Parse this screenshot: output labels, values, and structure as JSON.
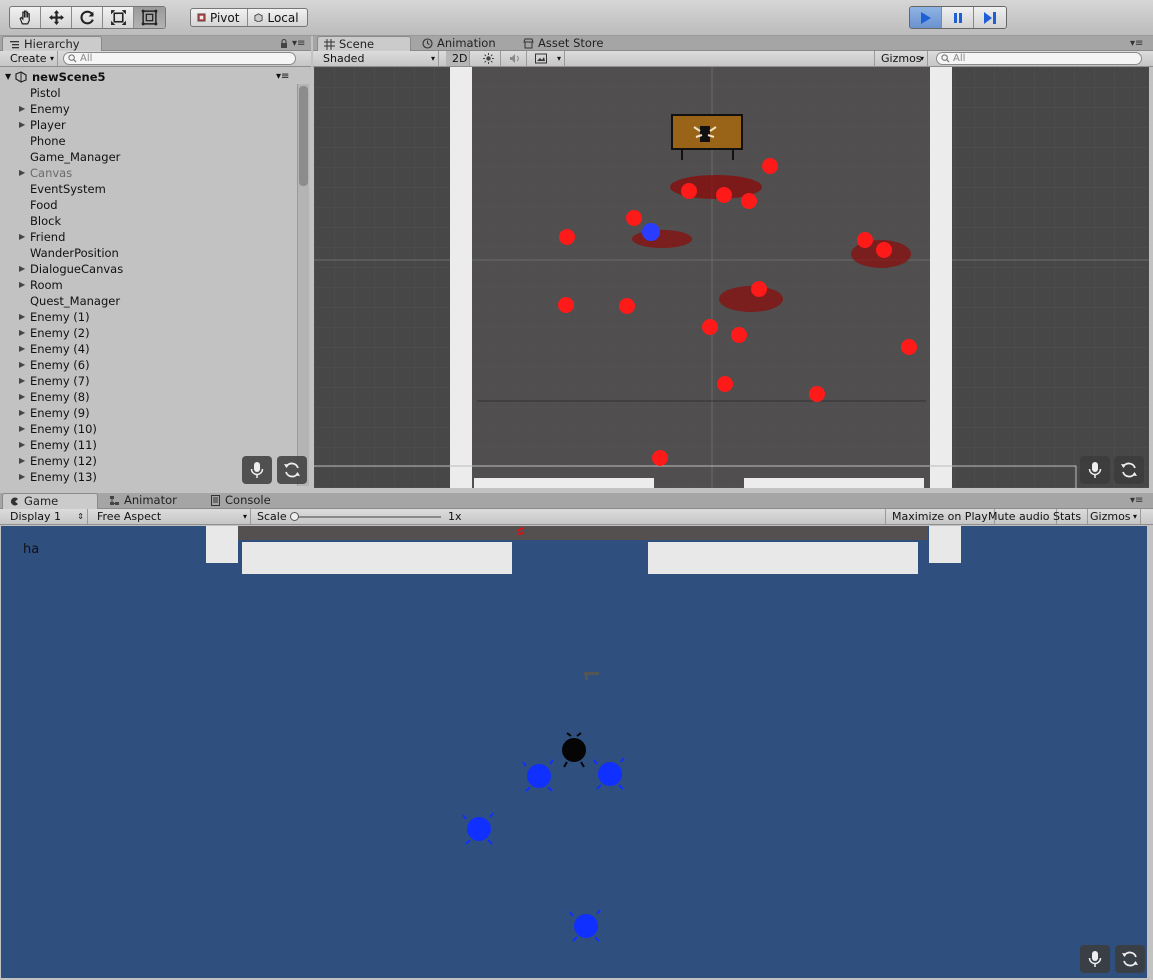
{
  "toolbar": {
    "tools": [
      {
        "name": "hand-tool-icon",
        "active": false
      },
      {
        "name": "move-tool-icon",
        "active": false
      },
      {
        "name": "rotate-tool-icon",
        "active": false
      },
      {
        "name": "scale-tool-icon",
        "active": false
      },
      {
        "name": "rect-tool-icon",
        "active": true
      }
    ],
    "pivot_label": "Pivot",
    "local_label": "Local"
  },
  "hierarchy": {
    "tab_label": "Hierarchy",
    "create_label": "Create",
    "search_placeholder": "All",
    "scene_name": "newScene5",
    "items": [
      {
        "label": "Pistol",
        "expandable": false,
        "dim": false
      },
      {
        "label": "Enemy",
        "expandable": true,
        "dim": false
      },
      {
        "label": "Player",
        "expandable": true,
        "dim": false
      },
      {
        "label": "Phone",
        "expandable": false,
        "dim": false
      },
      {
        "label": "Game_Manager",
        "expandable": false,
        "dim": false
      },
      {
        "label": "Canvas",
        "expandable": true,
        "dim": true
      },
      {
        "label": "EventSystem",
        "expandable": false,
        "dim": false
      },
      {
        "label": "Food",
        "expandable": false,
        "dim": false
      },
      {
        "label": "Block",
        "expandable": false,
        "dim": false
      },
      {
        "label": "Friend",
        "expandable": true,
        "dim": false
      },
      {
        "label": "WanderPosition",
        "expandable": false,
        "dim": false
      },
      {
        "label": "DialogueCanvas",
        "expandable": true,
        "dim": false
      },
      {
        "label": "Room",
        "expandable": true,
        "dim": false
      },
      {
        "label": "Quest_Manager",
        "expandable": false,
        "dim": false
      },
      {
        "label": "Enemy (1)",
        "expandable": true,
        "dim": false
      },
      {
        "label": "Enemy (2)",
        "expandable": true,
        "dim": false
      },
      {
        "label": "Enemy (4)",
        "expandable": true,
        "dim": false
      },
      {
        "label": "Enemy (6)",
        "expandable": true,
        "dim": false
      },
      {
        "label": "Enemy (7)",
        "expandable": true,
        "dim": false
      },
      {
        "label": "Enemy (8)",
        "expandable": true,
        "dim": false
      },
      {
        "label": "Enemy (9)",
        "expandable": true,
        "dim": false
      },
      {
        "label": "Enemy (10)",
        "expandable": true,
        "dim": false
      },
      {
        "label": "Enemy (11)",
        "expandable": true,
        "dim": false
      },
      {
        "label": "Enemy (12)",
        "expandable": true,
        "dim": false
      },
      {
        "label": "Enemy (13)",
        "expandable": true,
        "dim": false
      }
    ]
  },
  "scene": {
    "tabs": [
      {
        "label": "Scene",
        "icon": "grid-icon",
        "active": true
      },
      {
        "label": "Animation",
        "icon": "clock-icon",
        "active": false
      },
      {
        "label": "Asset Store",
        "icon": "store-icon",
        "active": false
      }
    ],
    "shading_mode": "Shaded",
    "mode_2d": "2D",
    "gizmos_label": "Gizmos",
    "search_placeholder": "All"
  },
  "game": {
    "tabs": [
      {
        "label": "Game",
        "icon": "gamepad-icon",
        "active": true
      },
      {
        "label": "Animator",
        "icon": "animator-icon",
        "active": false
      },
      {
        "label": "Console",
        "icon": "console-icon",
        "active": false
      }
    ],
    "display": "Display 1",
    "aspect": "Free Aspect",
    "scale_label": "Scale",
    "scale_value": "1x",
    "maximize_label": "Maximize on Play",
    "mute_label": "Mute audio",
    "stats_label": "Stats",
    "gizmos_label": "Gizmos",
    "overlay_text": "ha"
  },
  "colors": {
    "game_bg": "#2f4f7f",
    "scene_bg": "#4a4a4a",
    "enemy": "#ff1a1a",
    "friend": "#1030ff"
  }
}
